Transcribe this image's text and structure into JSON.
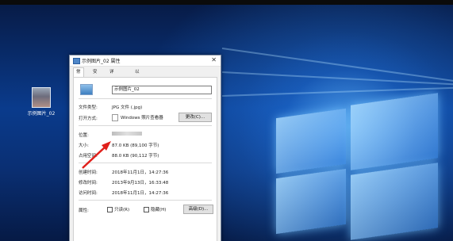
{
  "desktop": {
    "icon_label": "示例图片_02"
  },
  "dialog": {
    "title": "示例图片_02 属性",
    "close_glyph": "✕",
    "tabs": [
      {
        "label": "常规",
        "active": true
      },
      {
        "label": "安全",
        "active": false
      },
      {
        "label": "详细信息",
        "active": false
      },
      {
        "label": "以前的版本",
        "active": false
      }
    ],
    "file_name": "示例图片_02",
    "rows": {
      "file_type_label": "文件类型:",
      "file_type_value": "JPG 文件 (.jpg)",
      "open_with_label": "打开方式:",
      "open_with_value": "Windows 照片查看器",
      "change_button": "更改(C)...",
      "location_label": "位置:",
      "size_label": "大小:",
      "size_value": "87.0 KB (89,100 字节)",
      "size_on_disk_label": "占用空间:",
      "size_on_disk_value": "88.0 KB (90,112 字节)",
      "created_label": "创建时间:",
      "created_value": "2018年11月1日，14:27:36",
      "modified_label": "修改时间:",
      "modified_value": "2013年9月13日，16:33:48",
      "accessed_label": "访问时间:",
      "accessed_value": "2018年11月1日，14:27:36",
      "attributes_label": "属性:",
      "readonly_label": "只读(R)",
      "hidden_label": "隐藏(H)",
      "advanced_button": "高级(D)..."
    }
  },
  "colors": {
    "arrow": "#e0201b",
    "desktop_blue": "#0a3b8c"
  }
}
